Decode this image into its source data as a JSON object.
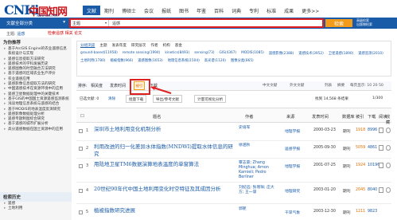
{
  "logo": {
    "mark": "CNKi",
    "cn": "中国知网",
    "url": "www.cnki.net"
  },
  "nav": {
    "tabs": [
      "文献",
      "期刊",
      "博硕士",
      "会议",
      "报纸",
      "图书",
      "年鉴",
      "百科",
      "词典",
      "专利",
      "标准",
      "成果",
      "更多>>"
    ]
  },
  "search": {
    "category_label": "文献全部分类",
    "field": "主题",
    "query": "遥感",
    "button": "检索",
    "right_links": [
      "高级检索",
      "出版物检索",
      "结果中检索"
    ]
  },
  "breadcrumb": {
    "prefix": "主题:",
    "term": "遥感",
    "suffix": "找到 14,568 条结果",
    "hint": "检索遥感 相关 论文"
  },
  "sidebar": {
    "title": "为你推荐",
    "items": [
      "基于ArcGIS Engine的农业遥感信息系统设计与实现",
      "遥感信息提取方法研究",
      "遥感技术的学科发展历史",
      "遥感图像的时空融合方法研究",
      "基于遥感的区域农业生产评价",
      "农业遥感应用",
      "遥感影像信息提取方法的研究",
      "中国遥感技术在资源环境中的应用",
      "遥感卫星数据处理中的关键技术",
      "基于GIS的中国国土资源遥感监测系统",
      "浅谈地理信息系统与遥感的结合",
      "基于MODIS的地表温度反演研究",
      "遥感影像数据处理分析",
      "遥感专题制图综合研究",
      "基于遥感的城市扩展分析",
      "高分遥感数据在国土资源中的应用"
    ],
    "history_title": "检索历史",
    "history": [
      "遥感",
      "土地利用"
    ]
  },
  "tag_tabs": [
    "分组浏览",
    "主题",
    "发表年度",
    "研究层次",
    "作者",
    "机构",
    "基金"
  ],
  "tags": [
    "ground-based(11958)",
    "remote sensing(1994)",
    "kinetics(8493)",
    "sensing(73)",
    "GIS(4367)",
    "MODIS(1085)",
    "遥感影像(2388)",
    "遥感技术(3952)",
    "卫星遥感(1890)",
    "遥感监测(2010)",
    "土地利用(1780)",
    "植被指数(966)",
    "遥感图像(1653)",
    "地理信息系统(1504)",
    "高光谱(1120)",
    "图像分类(865)"
  ],
  "sort": {
    "label": "排序:",
    "relevance": "相关度",
    "date": "发表时间",
    "cite": "被引",
    "download": "下载",
    "summary": "中文文献",
    "abstract": "外文文献",
    "view": "列表",
    "detail": "摘要",
    "perpage": "每页显示: 10 20 50"
  },
  "toolbar": {
    "selected": "已选文献: 0",
    "clear": "清除",
    "batch": "批量下载",
    "export": "导出/参考文献",
    "analysis": "计量可视化分析",
    "count": "找到 14,568 条结果",
    "page": "1/300"
  },
  "columns": {
    "title": "题名",
    "author": "作者",
    "source": "来源",
    "date": "发表时间",
    "db": "数据库",
    "cite": "被引",
    "download": "下载",
    "read": "阅读",
    "fav": "收藏"
  },
  "rows": [
    {
      "n": "1",
      "title": "深圳市土地利用变化机制分析",
      "author": "史培军",
      "source": "地理学报",
      "date": "2000-03-23",
      "db": "期刊",
      "cite": "1918",
      "dl": "8996"
    },
    {
      "n": "2",
      "title": "利用改进的归一化差异水体指数(MNDWI)提取水体信息的研究",
      "author": "徐涵秋",
      "source": "遥感学报",
      "date": "2005-09-30",
      "db": "期刊",
      "cite": "5059",
      "dl": "4861"
    },
    {
      "n": "3",
      "title": "用陆地卫星TM6数据演算地表温度的单窗算法",
      "author": "覃志豪; Zhang Minghua; Arnon Karnieli; Pedro Berliner",
      "source": "地理学报",
      "date": "2001-07-25",
      "db": "期刊",
      "cite": "1924",
      "dl": "10196"
    },
    {
      "n": "4",
      "title": "20世纪90年代中国土地利用变化时空特征及其成因分析",
      "author": "刘纪远; 张增祥; 庄大方; 王一谋",
      "source": "地理研究",
      "date": "2003-01-20",
      "db": "期刊",
      "cite": "2045",
      "dl": "8040"
    },
    {
      "n": "5",
      "title": "植被指数研究进展",
      "author": "郭铌",
      "source": "干旱气象",
      "date": "2003-12-30",
      "db": "期刊",
      "cite": "1211",
      "dl": "9823"
    }
  ]
}
